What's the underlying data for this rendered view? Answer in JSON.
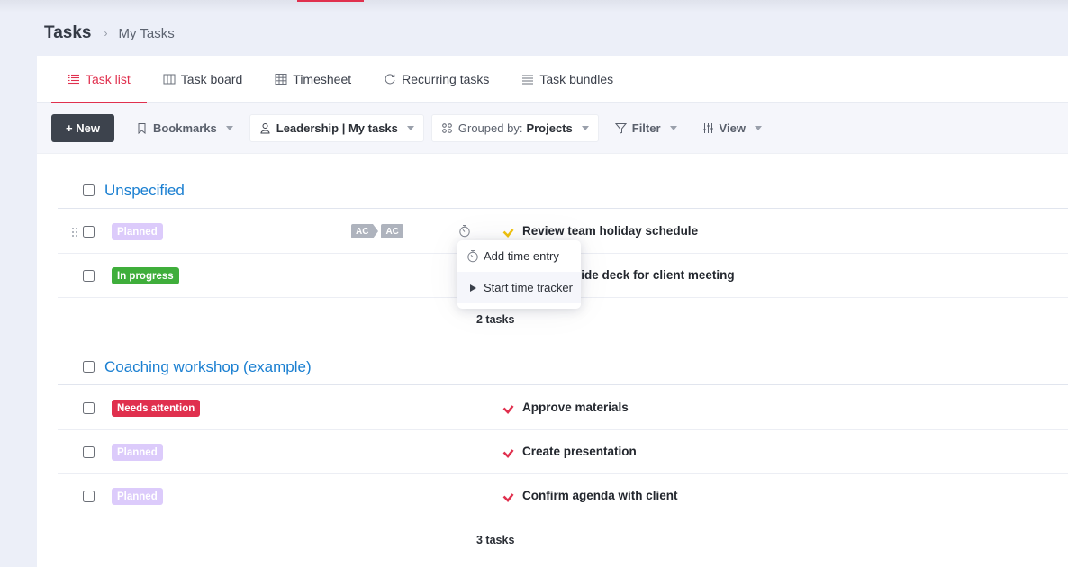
{
  "header": {
    "title": "Tasks",
    "breadcrumb_separator": "›",
    "breadcrumb_current": "My Tasks"
  },
  "tabs": [
    {
      "label": "Task list",
      "icon": "list-icon",
      "active": true
    },
    {
      "label": "Task board",
      "icon": "columns-icon",
      "active": false
    },
    {
      "label": "Timesheet",
      "icon": "grid-icon",
      "active": false
    },
    {
      "label": "Recurring tasks",
      "icon": "refresh-icon",
      "active": false
    },
    {
      "label": "Task bundles",
      "icon": "stack-icon",
      "active": false
    }
  ],
  "toolbar": {
    "new_label": "+ New",
    "bookmarks_label": "Bookmarks",
    "view_selector_label": "Leadership | My tasks",
    "grouped_prefix": "Grouped by:",
    "grouped_value": "Projects",
    "filter_label": "Filter",
    "view_label": "View"
  },
  "colors": {
    "accent": "#e0304e",
    "group_title": "#1a7fd1",
    "planned": "#dccbfb",
    "in_progress": "#3fae3b",
    "needs_attention": "#e0304e",
    "check_yellow": "#f2c40f",
    "check_red": "#e0304e"
  },
  "groups": [
    {
      "title": "Unspecified",
      "count_label": "2 tasks",
      "tasks": [
        {
          "status": "Planned",
          "title": "Review team holiday schedule",
          "assignees": [
            "AC",
            "AC"
          ],
          "check_color": "yellow"
        },
        {
          "status": "In progress",
          "title": "Prepare slide deck for client meeting",
          "assignees": [],
          "check_color": "none"
        }
      ]
    },
    {
      "title": "Coaching workshop (example)",
      "count_label": "3 tasks",
      "tasks": [
        {
          "status": "Needs attention",
          "title": "Approve materials",
          "assignees": [],
          "check_color": "red"
        },
        {
          "status": "Planned",
          "title": "Create presentation",
          "assignees": [],
          "check_color": "red"
        },
        {
          "status": "Planned",
          "title": "Confirm agenda with client",
          "assignees": [],
          "check_color": "red"
        }
      ]
    }
  ],
  "time_menu": {
    "items": [
      {
        "label": "Add time entry",
        "icon": "stopwatch-icon"
      },
      {
        "label": "Start time tracker",
        "icon": "play-icon"
      }
    ]
  }
}
